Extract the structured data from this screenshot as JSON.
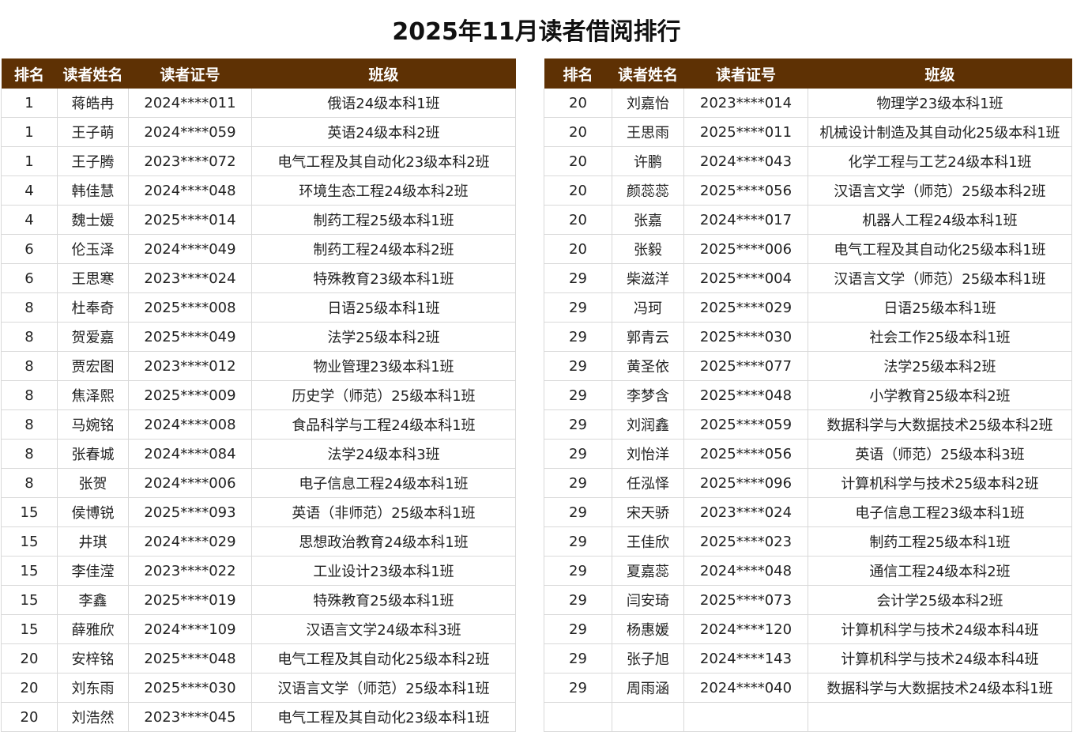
{
  "title": "2025年11月读者借阅排行",
  "headers": [
    "排名",
    "读者姓名",
    "读者证号",
    "班级"
  ],
  "left_rows": [
    [
      "1",
      "蒋皓冉",
      "2024****011",
      "俄语24级本科1班"
    ],
    [
      "1",
      "王子萌",
      "2024****059",
      "英语24级本科2班"
    ],
    [
      "1",
      "王子腾",
      "2023****072",
      "电气工程及其自动化23级本科2班"
    ],
    [
      "4",
      "韩佳慧",
      "2024****048",
      "环境生态工程24级本科2班"
    ],
    [
      "4",
      "魏士媛",
      "2025****014",
      "制药工程25级本科1班"
    ],
    [
      "6",
      "伦玉泽",
      "2024****049",
      "制药工程24级本科2班"
    ],
    [
      "6",
      "王思寒",
      "2023****024",
      "特殊教育23级本科1班"
    ],
    [
      "8",
      "杜奉奇",
      "2025****008",
      "日语25级本科1班"
    ],
    [
      "8",
      "贺爱嘉",
      "2025****049",
      "法学25级本科2班"
    ],
    [
      "8",
      "贾宏图",
      "2023****012",
      "物业管理23级本科1班"
    ],
    [
      "8",
      "焦泽熙",
      "2025****009",
      "历史学（师范）25级本科1班"
    ],
    [
      "8",
      "马婉铭",
      "2024****008",
      "食品科学与工程24级本科1班"
    ],
    [
      "8",
      "张春城",
      "2024****084",
      "法学24级本科3班"
    ],
    [
      "8",
      "张贺",
      "2024****006",
      "电子信息工程24级本科1班"
    ],
    [
      "15",
      "侯博锐",
      "2025****093",
      "英语（非师范）25级本科1班"
    ],
    [
      "15",
      "井琪",
      "2024****029",
      "思想政治教育24级本科1班"
    ],
    [
      "15",
      "李佳滢",
      "2023****022",
      "工业设计23级本科1班"
    ],
    [
      "15",
      "李鑫",
      "2025****019",
      "特殊教育25级本科1班"
    ],
    [
      "15",
      "薛雅欣",
      "2024****109",
      "汉语言文学24级本科3班"
    ],
    [
      "20",
      "安梓铭",
      "2025****048",
      "电气工程及其自动化25级本科2班"
    ],
    [
      "20",
      "刘东雨",
      "2025****030",
      "汉语言文学（师范）25级本科1班"
    ],
    [
      "20",
      "刘浩然",
      "2023****045",
      "电气工程及其自动化23级本科1班"
    ]
  ],
  "right_rows": [
    [
      "20",
      "刘嘉怡",
      "2023****014",
      "物理学23级本科1班"
    ],
    [
      "20",
      "王思雨",
      "2025****011",
      "机械设计制造及其自动化25级本科1班"
    ],
    [
      "20",
      "许鹏",
      "2024****043",
      "化学工程与工艺24级本科1班"
    ],
    [
      "20",
      "颜蕊蕊",
      "2025****056",
      "汉语言文学（师范）25级本科2班"
    ],
    [
      "20",
      "张嘉",
      "2024****017",
      "机器人工程24级本科1班"
    ],
    [
      "20",
      "张毅",
      "2025****006",
      "电气工程及其自动化25级本科1班"
    ],
    [
      "29",
      "柴滋洋",
      "2025****004",
      "汉语言文学（师范）25级本科1班"
    ],
    [
      "29",
      "冯珂",
      "2025****029",
      "日语25级本科1班"
    ],
    [
      "29",
      "郭青云",
      "2025****030",
      "社会工作25级本科1班"
    ],
    [
      "29",
      "黄圣依",
      "2025****077",
      "法学25级本科2班"
    ],
    [
      "29",
      "李梦含",
      "2025****048",
      "小学教育25级本科2班"
    ],
    [
      "29",
      "刘润鑫",
      "2025****059",
      "数据科学与大数据技术25级本科2班"
    ],
    [
      "29",
      "刘怡洋",
      "2025****056",
      "英语（师范）25级本科3班"
    ],
    [
      "29",
      "任泓怿",
      "2025****096",
      "计算机科学与技术25级本科2班"
    ],
    [
      "29",
      "宋天骄",
      "2023****024",
      "电子信息工程23级本科1班"
    ],
    [
      "29",
      "王佳欣",
      "2025****023",
      "制药工程25级本科1班"
    ],
    [
      "29",
      "夏嘉蕊",
      "2024****048",
      "通信工程24级本科2班"
    ],
    [
      "29",
      "闫安琦",
      "2025****073",
      "会计学25级本科2班"
    ],
    [
      "29",
      "杨惠媛",
      "2024****120",
      "计算机科学与技术24级本科4班"
    ],
    [
      "29",
      "张子旭",
      "2024****143",
      "计算机科学与技术24级本科4班"
    ],
    [
      "29",
      "周雨涵",
      "2024****040",
      "数据科学与大数据技术24级本科1班"
    ],
    [
      "",
      "",
      "",
      ""
    ]
  ]
}
